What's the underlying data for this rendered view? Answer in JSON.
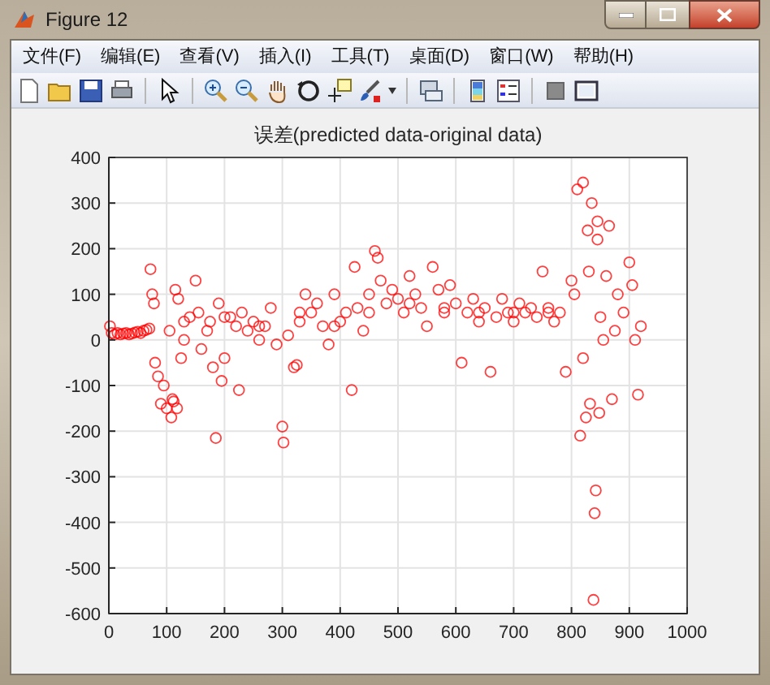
{
  "window": {
    "title": "Figure 12"
  },
  "menu": [
    {
      "label": "文件(F)"
    },
    {
      "label": "编辑(E)"
    },
    {
      "label": "查看(V)"
    },
    {
      "label": "插入(I)"
    },
    {
      "label": "工具(T)"
    },
    {
      "label": "桌面(D)"
    },
    {
      "label": "窗口(W)"
    },
    {
      "label": "帮助(H)"
    }
  ],
  "figure": {
    "chart_data": {
      "type": "scatter",
      "title": "误差(predicted data-original data)",
      "x": [
        2,
        5,
        10,
        15,
        20,
        25,
        30,
        35,
        40,
        45,
        50,
        55,
        60,
        65,
        70,
        72,
        75,
        78,
        80,
        85,
        90,
        95,
        100,
        105,
        108,
        110,
        112,
        115,
        118,
        120,
        125,
        130,
        140,
        150,
        155,
        160,
        170,
        175,
        180,
        185,
        190,
        195,
        200,
        210,
        220,
        225,
        230,
        240,
        250,
        260,
        270,
        280,
        290,
        300,
        302,
        310,
        320,
        325,
        330,
        340,
        350,
        360,
        370,
        380,
        390,
        400,
        410,
        420,
        425,
        430,
        440,
        450,
        460,
        465,
        470,
        480,
        490,
        500,
        510,
        520,
        530,
        540,
        550,
        560,
        570,
        580,
        590,
        600,
        610,
        620,
        630,
        640,
        650,
        660,
        670,
        680,
        690,
        700,
        710,
        720,
        730,
        740,
        750,
        760,
        770,
        780,
        790,
        800,
        805,
        810,
        815,
        820,
        820,
        825,
        828,
        830,
        832,
        835,
        838,
        840,
        842,
        845,
        845,
        848,
        850,
        855,
        860,
        865,
        870,
        875,
        880,
        890,
        900,
        905,
        910,
        915,
        920,
        130,
        200,
        260,
        330,
        390,
        450,
        520,
        580,
        640,
        700,
        760
      ],
      "series": [
        {
          "color": "#ff0000",
          "values": [
            30,
            15,
            12,
            15,
            12,
            14,
            15,
            12,
            14,
            16,
            18,
            15,
            20,
            22,
            25,
            155,
            100,
            80,
            -50,
            -80,
            -140,
            -100,
            -150,
            20,
            -170,
            -130,
            -135,
            110,
            -150,
            90,
            -40,
            0,
            50,
            130,
            60,
            -20,
            20,
            40,
            -60,
            -215,
            80,
            -90,
            -40,
            50,
            30,
            -110,
            60,
            20,
            40,
            0,
            30,
            70,
            -10,
            -190,
            -225,
            10,
            -60,
            -55,
            40,
            100,
            60,
            80,
            30,
            -10,
            100,
            40,
            60,
            -110,
            160,
            70,
            20,
            100,
            195,
            180,
            130,
            80,
            110,
            90,
            60,
            140,
            100,
            70,
            30,
            160,
            110,
            60,
            120,
            80,
            -50,
            60,
            90,
            40,
            70,
            -70,
            50,
            90,
            60,
            40,
            80,
            60,
            70,
            50,
            150,
            60,
            40,
            60,
            -70,
            130,
            100,
            330,
            -210,
            -40,
            345,
            -170,
            240,
            150,
            -140,
            300,
            -570,
            -380,
            -330,
            260,
            220,
            -160,
            50,
            0,
            140,
            250,
            -130,
            20,
            100,
            60,
            170,
            120,
            0,
            -120,
            30,
            40,
            50,
            30,
            60,
            30,
            60,
            80,
            70,
            60,
            60,
            70
          ]
        }
      ],
      "grid": true,
      "xlim": [
        0,
        1000
      ],
      "ylim": [
        -600,
        400
      ],
      "xticks": [
        0,
        100,
        200,
        300,
        400,
        500,
        600,
        700,
        800,
        900,
        1000
      ],
      "yticks": [
        -600,
        -500,
        -400,
        -300,
        -200,
        -100,
        0,
        100,
        200,
        300,
        400
      ]
    }
  }
}
